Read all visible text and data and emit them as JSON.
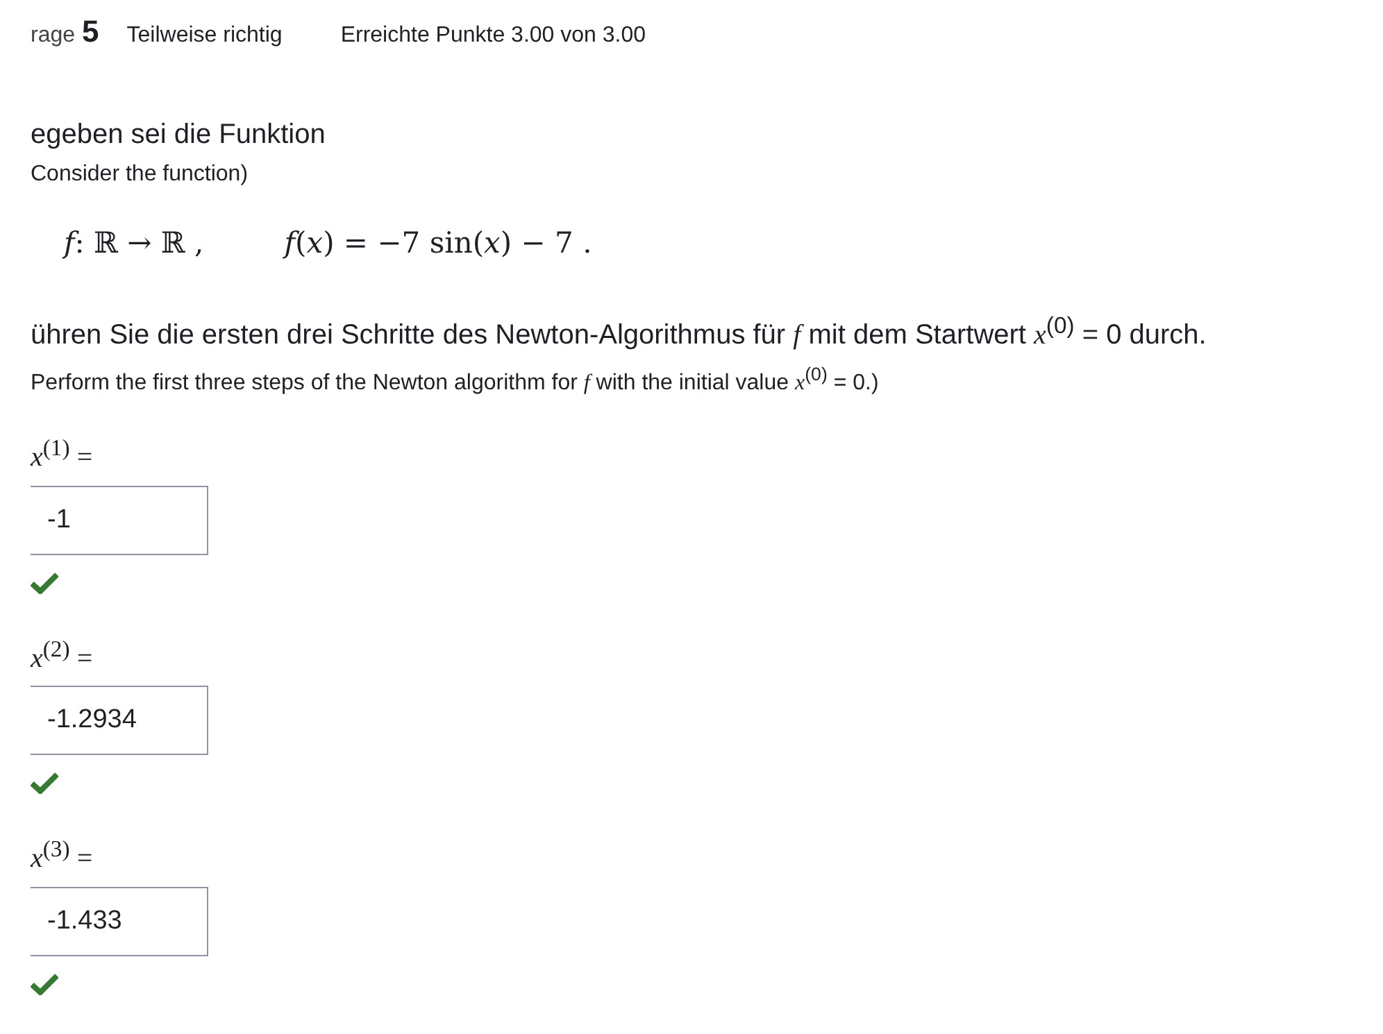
{
  "header": {
    "label": "rage",
    "number": "5",
    "state": "Teilweise richtig",
    "grade": "Erreichte Punkte 3.00 von 3.00"
  },
  "question": {
    "text": "egeben sei die Funktion",
    "translation": "Consider the function)",
    "formulas": [
      "*f*: ℝ → ℝ ,",
      "*f*(*x*) = −7 sin(*x*) − 7 ."
    ],
    "task": "ühren Sie die ersten drei Schritte des Newton-Algorithmus für *f* mit dem Startwert *x*$^{(0)}$ = 0 durch.",
    "task_translation": "Perform the first three steps of the Newton algorithm for *f* with the initial value *x*$^{(0)}$ = 0.)"
  },
  "answers": [
    {
      "label": "*x*$^{(1)}$ =",
      "value": "-1",
      "correct": true
    },
    {
      "label": "*x*$^{(2)}$ =",
      "value": "-1.2934",
      "correct": true
    },
    {
      "label": "*x*$^{(3)}$ =",
      "value": "-1.433",
      "correct": true
    }
  ]
}
